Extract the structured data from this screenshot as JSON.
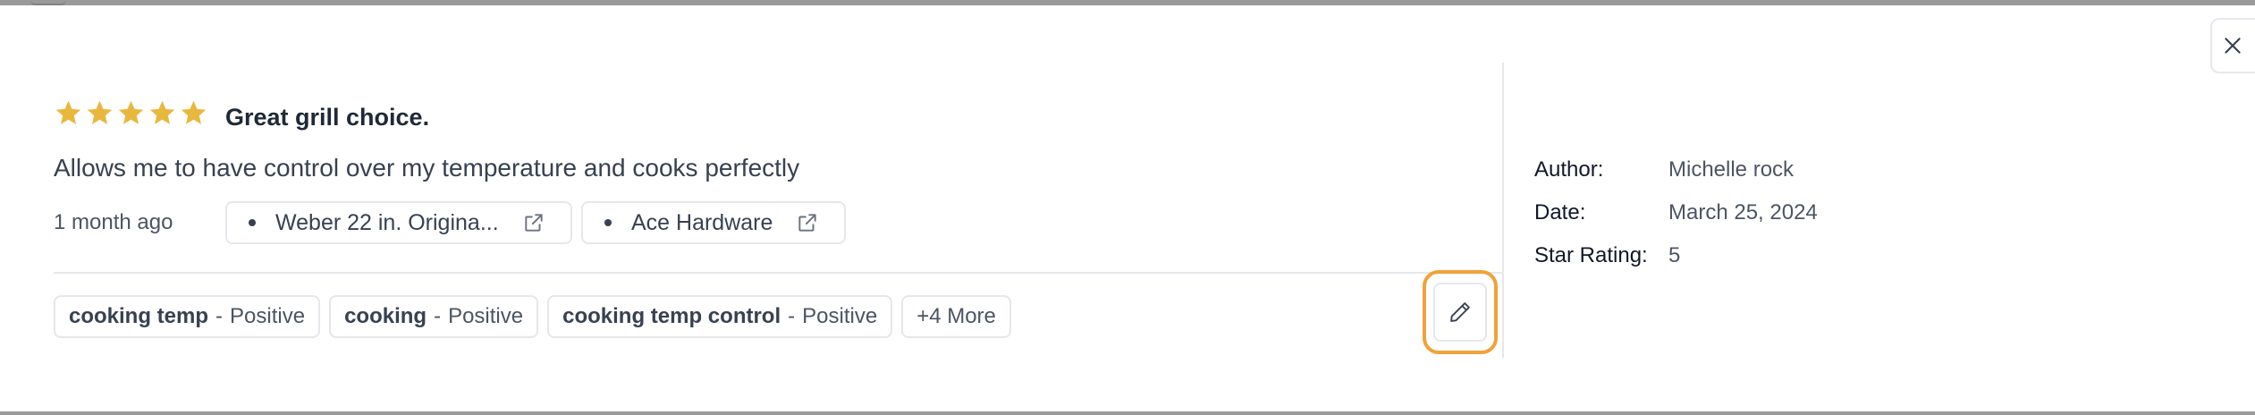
{
  "review": {
    "rating": 5,
    "title": "Great grill choice.",
    "body": "Allows me to have control over my temperature and cooks perfectly",
    "time_ago": "1 month ago",
    "product_chip": "Weber 22 in. Origina...",
    "store_chip": "Ace Hardware",
    "tags": [
      {
        "name": "cooking temp",
        "sep": "-",
        "sentiment": "Positive"
      },
      {
        "name": "cooking",
        "sep": "-",
        "sentiment": "Positive"
      },
      {
        "name": "cooking temp control",
        "sep": "-",
        "sentiment": "Positive"
      }
    ],
    "more_label": "+4 More"
  },
  "details": {
    "author_label": "Author:",
    "author_value": "Michelle rock",
    "date_label": "Date:",
    "date_value": "March 25, 2024",
    "rating_label": "Star Rating:",
    "rating_value": "5"
  },
  "icons": {
    "star": "star-icon",
    "external": "external-link-icon",
    "edit": "pencil-icon",
    "close": "close-icon"
  },
  "colors": {
    "star": "#e8b83e",
    "highlight": "#f0a23a",
    "border": "#e5e7eb"
  }
}
